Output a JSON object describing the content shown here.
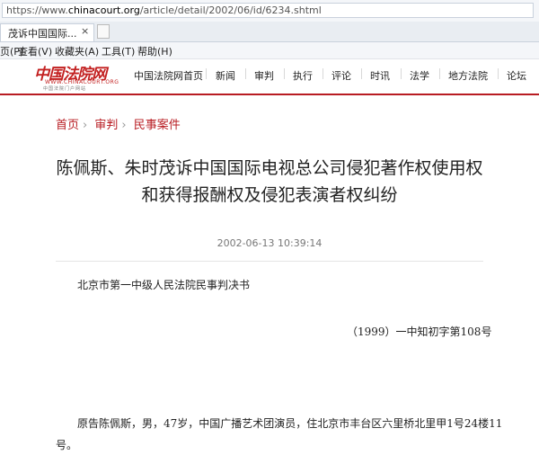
{
  "browser": {
    "url_prefix": "https://www.",
    "url_domain": "chinacourt.org",
    "url_path": "/article/detail/2002/06/id/6234.shtml",
    "tab_title": "茂诉中国国际...",
    "tab_close": "×",
    "menu": [
      "页(P)",
      "查看(V)",
      "收藏夹(A)",
      "工具(T)",
      "帮助(H)"
    ]
  },
  "site": {
    "logo_cn": "中国法院网",
    "logo_en": "WWW.CHINACOURT.ORG",
    "logo_sub": "中国法院门户网站",
    "nav": [
      "中国法院网首页",
      "新闻",
      "审判",
      "执行",
      "评论",
      "时讯",
      "法学",
      "地方法院",
      "论坛"
    ],
    "accent_color": "#b81c22"
  },
  "breadcrumb": [
    "首页",
    "审判",
    "民事案件"
  ],
  "breadcrumb_sep": "›",
  "article": {
    "title_line1": "陈佩斯、朱时茂诉中国国际电视总公司侵犯著作权使用权",
    "title_line2": "和获得报酬权及侵犯表演者权纠纷",
    "date": "2002-06-13 10:39:14",
    "court_line": "北京市第一中级人民法院民事判决书",
    "case_no": "（1999）一中知初字第108号",
    "para1_line1": "原告陈佩斯，男，47岁，中国广播艺术团演员，住北京市丰台区六里桥北里甲1号24楼11",
    "para1_line2": "号。"
  }
}
